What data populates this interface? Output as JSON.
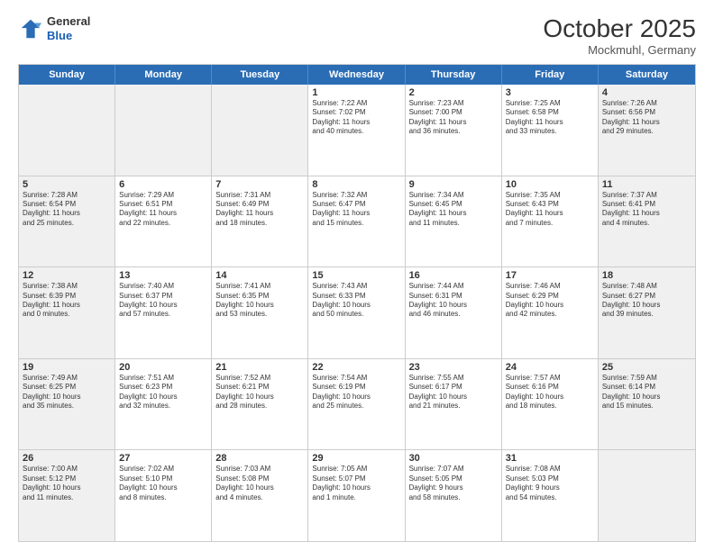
{
  "logo": {
    "general": "General",
    "blue": "Blue"
  },
  "header": {
    "month": "October 2025",
    "location": "Mockmuhl, Germany"
  },
  "weekdays": [
    "Sunday",
    "Monday",
    "Tuesday",
    "Wednesday",
    "Thursday",
    "Friday",
    "Saturday"
  ],
  "rows": [
    [
      {
        "day": "",
        "info": "",
        "shaded": true
      },
      {
        "day": "",
        "info": "",
        "shaded": true
      },
      {
        "day": "",
        "info": "",
        "shaded": true
      },
      {
        "day": "1",
        "info": "Sunrise: 7:22 AM\nSunset: 7:02 PM\nDaylight: 11 hours\nand 40 minutes.",
        "shaded": false
      },
      {
        "day": "2",
        "info": "Sunrise: 7:23 AM\nSunset: 7:00 PM\nDaylight: 11 hours\nand 36 minutes.",
        "shaded": false
      },
      {
        "day": "3",
        "info": "Sunrise: 7:25 AM\nSunset: 6:58 PM\nDaylight: 11 hours\nand 33 minutes.",
        "shaded": false
      },
      {
        "day": "4",
        "info": "Sunrise: 7:26 AM\nSunset: 6:56 PM\nDaylight: 11 hours\nand 29 minutes.",
        "shaded": true
      }
    ],
    [
      {
        "day": "5",
        "info": "Sunrise: 7:28 AM\nSunset: 6:54 PM\nDaylight: 11 hours\nand 25 minutes.",
        "shaded": true
      },
      {
        "day": "6",
        "info": "Sunrise: 7:29 AM\nSunset: 6:51 PM\nDaylight: 11 hours\nand 22 minutes.",
        "shaded": false
      },
      {
        "day": "7",
        "info": "Sunrise: 7:31 AM\nSunset: 6:49 PM\nDaylight: 11 hours\nand 18 minutes.",
        "shaded": false
      },
      {
        "day": "8",
        "info": "Sunrise: 7:32 AM\nSunset: 6:47 PM\nDaylight: 11 hours\nand 15 minutes.",
        "shaded": false
      },
      {
        "day": "9",
        "info": "Sunrise: 7:34 AM\nSunset: 6:45 PM\nDaylight: 11 hours\nand 11 minutes.",
        "shaded": false
      },
      {
        "day": "10",
        "info": "Sunrise: 7:35 AM\nSunset: 6:43 PM\nDaylight: 11 hours\nand 7 minutes.",
        "shaded": false
      },
      {
        "day": "11",
        "info": "Sunrise: 7:37 AM\nSunset: 6:41 PM\nDaylight: 11 hours\nand 4 minutes.",
        "shaded": true
      }
    ],
    [
      {
        "day": "12",
        "info": "Sunrise: 7:38 AM\nSunset: 6:39 PM\nDaylight: 11 hours\nand 0 minutes.",
        "shaded": true
      },
      {
        "day": "13",
        "info": "Sunrise: 7:40 AM\nSunset: 6:37 PM\nDaylight: 10 hours\nand 57 minutes.",
        "shaded": false
      },
      {
        "day": "14",
        "info": "Sunrise: 7:41 AM\nSunset: 6:35 PM\nDaylight: 10 hours\nand 53 minutes.",
        "shaded": false
      },
      {
        "day": "15",
        "info": "Sunrise: 7:43 AM\nSunset: 6:33 PM\nDaylight: 10 hours\nand 50 minutes.",
        "shaded": false
      },
      {
        "day": "16",
        "info": "Sunrise: 7:44 AM\nSunset: 6:31 PM\nDaylight: 10 hours\nand 46 minutes.",
        "shaded": false
      },
      {
        "day": "17",
        "info": "Sunrise: 7:46 AM\nSunset: 6:29 PM\nDaylight: 10 hours\nand 42 minutes.",
        "shaded": false
      },
      {
        "day": "18",
        "info": "Sunrise: 7:48 AM\nSunset: 6:27 PM\nDaylight: 10 hours\nand 39 minutes.",
        "shaded": true
      }
    ],
    [
      {
        "day": "19",
        "info": "Sunrise: 7:49 AM\nSunset: 6:25 PM\nDaylight: 10 hours\nand 35 minutes.",
        "shaded": true
      },
      {
        "day": "20",
        "info": "Sunrise: 7:51 AM\nSunset: 6:23 PM\nDaylight: 10 hours\nand 32 minutes.",
        "shaded": false
      },
      {
        "day": "21",
        "info": "Sunrise: 7:52 AM\nSunset: 6:21 PM\nDaylight: 10 hours\nand 28 minutes.",
        "shaded": false
      },
      {
        "day": "22",
        "info": "Sunrise: 7:54 AM\nSunset: 6:19 PM\nDaylight: 10 hours\nand 25 minutes.",
        "shaded": false
      },
      {
        "day": "23",
        "info": "Sunrise: 7:55 AM\nSunset: 6:17 PM\nDaylight: 10 hours\nand 21 minutes.",
        "shaded": false
      },
      {
        "day": "24",
        "info": "Sunrise: 7:57 AM\nSunset: 6:16 PM\nDaylight: 10 hours\nand 18 minutes.",
        "shaded": false
      },
      {
        "day": "25",
        "info": "Sunrise: 7:59 AM\nSunset: 6:14 PM\nDaylight: 10 hours\nand 15 minutes.",
        "shaded": true
      }
    ],
    [
      {
        "day": "26",
        "info": "Sunrise: 7:00 AM\nSunset: 5:12 PM\nDaylight: 10 hours\nand 11 minutes.",
        "shaded": true
      },
      {
        "day": "27",
        "info": "Sunrise: 7:02 AM\nSunset: 5:10 PM\nDaylight: 10 hours\nand 8 minutes.",
        "shaded": false
      },
      {
        "day": "28",
        "info": "Sunrise: 7:03 AM\nSunset: 5:08 PM\nDaylight: 10 hours\nand 4 minutes.",
        "shaded": false
      },
      {
        "day": "29",
        "info": "Sunrise: 7:05 AM\nSunset: 5:07 PM\nDaylight: 10 hours\nand 1 minute.",
        "shaded": false
      },
      {
        "day": "30",
        "info": "Sunrise: 7:07 AM\nSunset: 5:05 PM\nDaylight: 9 hours\nand 58 minutes.",
        "shaded": false
      },
      {
        "day": "31",
        "info": "Sunrise: 7:08 AM\nSunset: 5:03 PM\nDaylight: 9 hours\nand 54 minutes.",
        "shaded": false
      },
      {
        "day": "",
        "info": "",
        "shaded": true
      }
    ]
  ]
}
